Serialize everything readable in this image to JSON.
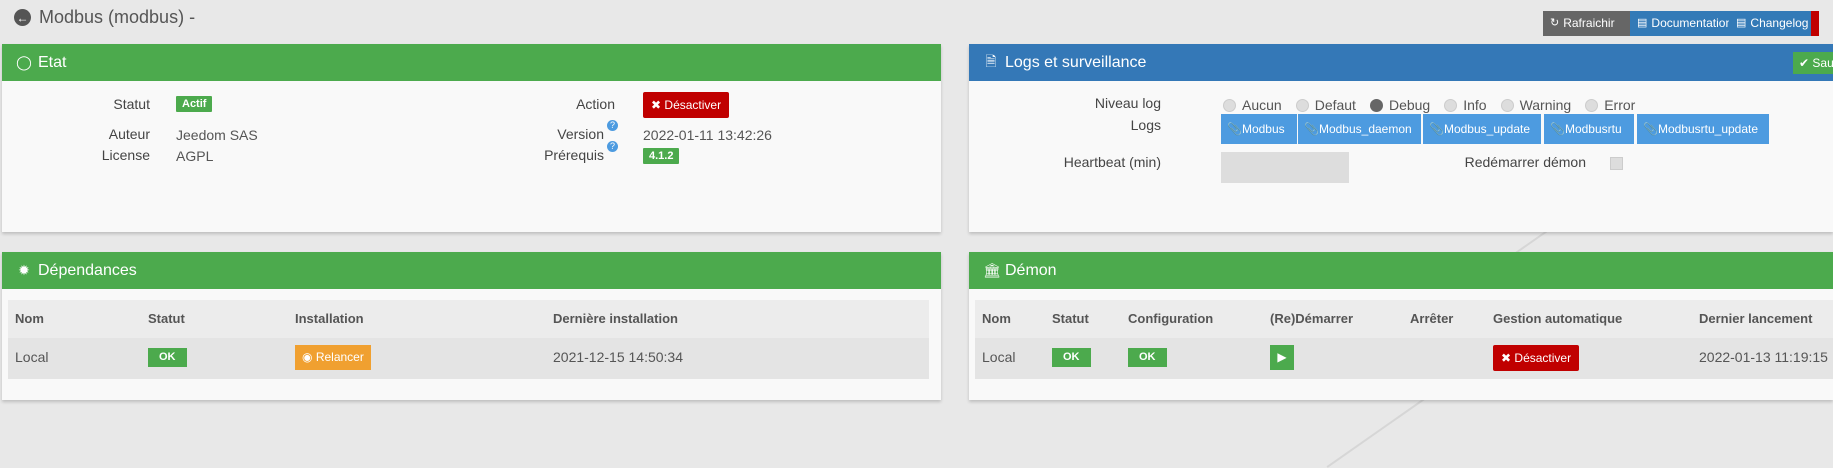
{
  "page": {
    "title": "Modbus (modbus) -"
  },
  "toolbar": {
    "refresh_label": "Rafraichir",
    "documentation_label": "Documentation",
    "changelog_label": "Changelog"
  },
  "etat": {
    "title": "Etat",
    "statut_label": "Statut",
    "statut_value": "Actif",
    "action_label": "Action",
    "action_button": "Désactiver",
    "auteur_label": "Auteur",
    "auteur_value": "Jeedom SAS",
    "version_label": "Version",
    "version_value": "2022-01-11 13:42:26",
    "license_label": "License",
    "license_value": "AGPL",
    "prerequis_label": "Prérequis",
    "prerequis_value": "4.1.2"
  },
  "logs": {
    "title": "Logs et surveillance",
    "save_label": "Sau",
    "niveau_label": "Niveau log",
    "levels": [
      {
        "label": "Aucun",
        "checked": false
      },
      {
        "label": "Defaut",
        "checked": false
      },
      {
        "label": "Debug",
        "checked": true
      },
      {
        "label": "Info",
        "checked": false
      },
      {
        "label": "Warning",
        "checked": false
      },
      {
        "label": "Error",
        "checked": false
      }
    ],
    "logs_label": "Logs",
    "log_buttons": [
      "Modbus",
      "Modbus_daemon",
      "Modbus_update",
      "Modbusrtu",
      "Modbusrtu_update"
    ],
    "heartbeat_label": "Heartbeat (min)",
    "heartbeat_value": "",
    "restart_label": "Redémarrer démon"
  },
  "deps": {
    "title": "Dépendances",
    "headers": [
      "Nom",
      "Statut",
      "Installation",
      "Dernière installation"
    ],
    "row": {
      "nom": "Local",
      "statut": "OK",
      "installation": "Relancer",
      "derniere": "2021-12-15 14:50:34"
    }
  },
  "demon": {
    "title": "Démon",
    "headers": [
      "Nom",
      "Statut",
      "Configuration",
      "(Re)Démarrer",
      "Arrêter",
      "Gestion automatique",
      "Dernier lancement"
    ],
    "row": {
      "nom": "Local",
      "statut": "OK",
      "configuration": "OK",
      "gestion": "Désactiver",
      "dernier": "2022-01-13 11:19:15"
    }
  },
  "colors": {
    "green": "#4caa4d",
    "blue": "#3478b7",
    "red": "#c00000",
    "orange": "#f0a030",
    "light_blue": "#4d9be0"
  }
}
